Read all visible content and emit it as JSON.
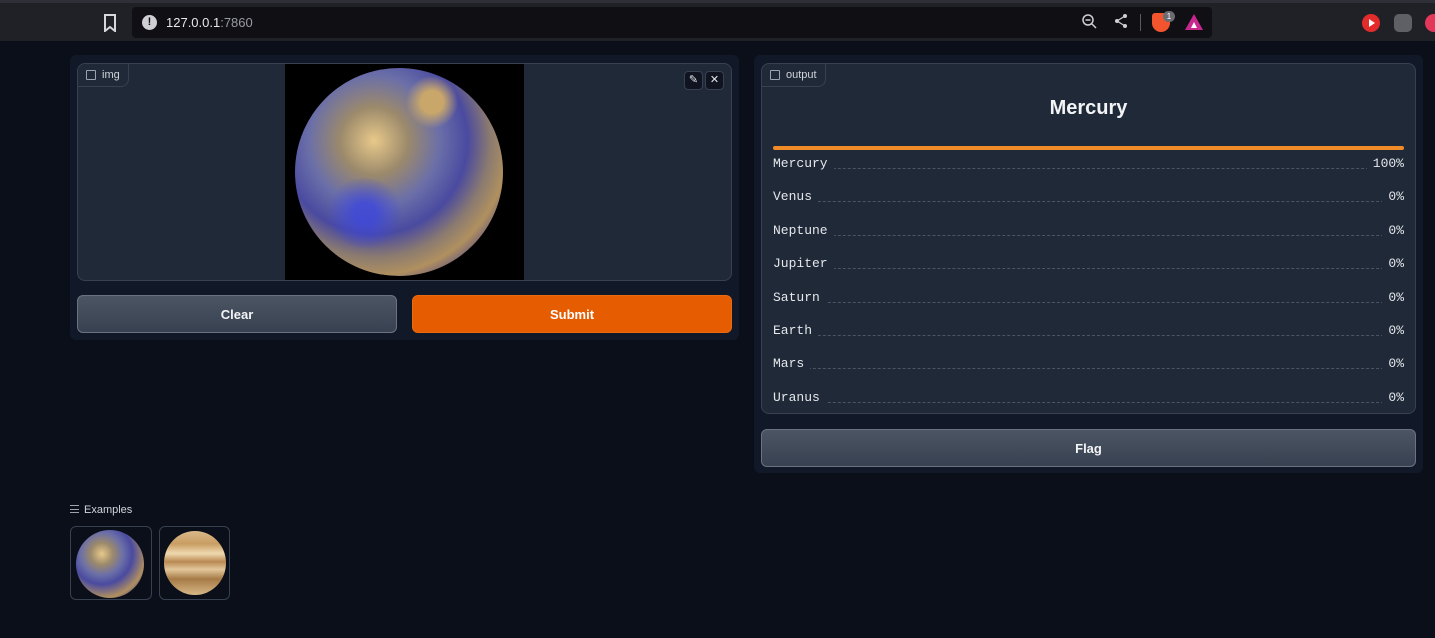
{
  "browser": {
    "url_host": "127.0.0.1",
    "url_port": ":7860",
    "brave_badge_count": "1"
  },
  "input_panel": {
    "image_label": "img",
    "clear_label": "Clear",
    "submit_label": "Submit"
  },
  "output_panel": {
    "label": "output",
    "top_class": "Mercury",
    "top_confidence_fraction": 1.0,
    "results": [
      {
        "label": "Mercury",
        "value": "100%"
      },
      {
        "label": "Venus",
        "value": "0%"
      },
      {
        "label": "Neptune",
        "value": "0%"
      },
      {
        "label": "Jupiter",
        "value": "0%"
      },
      {
        "label": "Saturn",
        "value": "0%"
      },
      {
        "label": "Earth",
        "value": "0%"
      },
      {
        "label": "Mars",
        "value": "0%"
      },
      {
        "label": "Uranus",
        "value": "0%"
      }
    ],
    "flag_label": "Flag"
  },
  "examples": {
    "title": "Examples"
  },
  "colors": {
    "primary": "#e65c00",
    "bar": "#f08b28",
    "background": "#0b0f19"
  }
}
